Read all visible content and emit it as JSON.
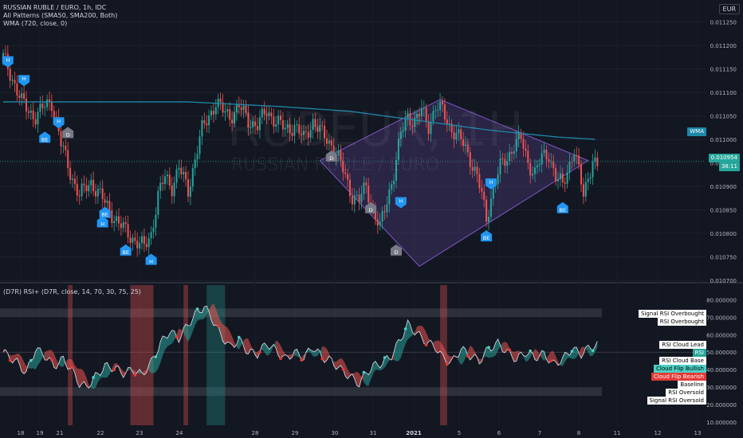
{
  "header": {
    "symbol_line": "RUSSIAN RUBLE / EURO, 1h, IDC",
    "patterns_line": "All Patterns (SMA50, SMA200, Both)",
    "wma_line": "WMA (720, close, 0)",
    "currency": "EUR"
  },
  "watermark": {
    "ticker": "RUBEUR, 1H",
    "name": "RUSSIAN RUBLE / EURO"
  },
  "price_tags": {
    "wma": "WMA",
    "last": "0.010954",
    "countdown": "38:11"
  },
  "rsi_header": "(D7R) RSI+ (D7R, close, 14, 70, 30, 75, 25)",
  "rsi_labels": [
    {
      "text": "Signal RSI Overbought",
      "bg": "#ffffff",
      "fg": "#000000"
    },
    {
      "text": "RSI Overbought",
      "bg": "#ffffff",
      "fg": "#000000"
    },
    {
      "text": "RSI Cloud Lead",
      "bg": "#ffffff",
      "fg": "#000000"
    },
    {
      "text": "RSI",
      "bg": "#26a69a",
      "fg": "#ffffff"
    },
    {
      "text": "RSI Cloud Base",
      "bg": "#ffffff",
      "fg": "#000000"
    },
    {
      "text": "Cloud Flip Bullish",
      "bg": "#4dd0c4",
      "fg": "#000000"
    },
    {
      "text": "Cloud Flip Bearish",
      "bg": "#e53935",
      "fg": "#ffffff"
    },
    {
      "text": "Baseline",
      "bg": "#ffffff",
      "fg": "#000000"
    },
    {
      "text": "RSI Oversold",
      "bg": "#ffffff",
      "fg": "#000000"
    },
    {
      "text": "Signal RSI Oversold",
      "bg": "#ffffff",
      "fg": "#000000"
    }
  ],
  "colors": {
    "up": "#26a69a",
    "down": "#ef5350",
    "wma": "#1e88a8",
    "diamond": "#7e57c2",
    "marker": "#2196f3",
    "marker_d": "#787b86",
    "bg": "#131722"
  },
  "chart_data": [
    {
      "type": "candlestick",
      "title": "RUSSIAN RUBLE / EURO, 1h, IDC",
      "y_ticks": [
        "0.011250",
        "0.011200",
        "0.011150",
        "0.011100",
        "0.011050",
        "0.011000",
        "0.010950",
        "0.010900",
        "0.010850",
        "0.010800",
        "0.010750",
        "0.010700"
      ],
      "ylim": [
        0.0107,
        0.01128
      ],
      "x_ticks": [
        "18",
        "19",
        "21",
        "22",
        "23",
        "24",
        "28",
        "29",
        "30",
        "31",
        "2021",
        "5",
        "6",
        "7",
        "8",
        "11",
        "12",
        "13"
      ],
      "close_path": [
        [
          0,
          0.011175
        ],
        [
          4,
          0.01113
        ],
        [
          8,
          0.01108
        ],
        [
          11,
          0.01106
        ],
        [
          14,
          0.01105
        ],
        [
          18,
          0.01107
        ],
        [
          21,
          0.01108
        ],
        [
          23,
          0.01104
        ],
        [
          25,
          0.01099
        ],
        [
          29,
          0.01093
        ],
        [
          33,
          0.01088
        ],
        [
          38,
          0.01091
        ],
        [
          42,
          0.01088
        ],
        [
          46,
          0.01085
        ],
        [
          50,
          0.01082
        ],
        [
          54,
          0.0108
        ],
        [
          58,
          0.01078
        ],
        [
          61,
          0.01077
        ],
        [
          64,
          0.0108
        ],
        [
          67,
          0.01088
        ],
        [
          70,
          0.01092
        ],
        [
          73,
          0.0109
        ],
        [
          76,
          0.01094
        ],
        [
          80,
          0.01089
        ],
        [
          83,
          0.01096
        ],
        [
          86,
          0.01102
        ],
        [
          89,
          0.01105
        ],
        [
          92,
          0.01108
        ],
        [
          95,
          0.01106
        ],
        [
          98,
          0.01105
        ],
        [
          102,
          0.01107
        ],
        [
          106,
          0.01104
        ],
        [
          110,
          0.01103
        ],
        [
          114,
          0.01106
        ],
        [
          118,
          0.01104
        ],
        [
          122,
          0.01102
        ],
        [
          126,
          0.01103
        ],
        [
          130,
          0.011
        ],
        [
          134,
          0.01104
        ],
        [
          138,
          0.01101
        ],
        [
          142,
          0.01099
        ],
        [
          145,
          0.01096
        ],
        [
          148,
          0.01092
        ],
        [
          151,
          0.01088
        ],
        [
          154,
          0.01087
        ],
        [
          157,
          0.0109
        ],
        [
          160,
          0.01085
        ],
        [
          163,
          0.01081
        ],
        [
          166,
          0.01087
        ],
        [
          169,
          0.01093
        ],
        [
          172,
          0.01101
        ],
        [
          175,
          0.01105
        ],
        [
          178,
          0.01104
        ],
        [
          181,
          0.01106
        ],
        [
          184,
          0.01103
        ],
        [
          187,
          0.01107
        ],
        [
          190,
          0.01106
        ],
        [
          193,
          0.01103
        ],
        [
          196,
          0.01101
        ],
        [
          199,
          0.01099
        ],
        [
          202,
          0.01096
        ],
        [
          205,
          0.01092
        ],
        [
          207,
          0.01088
        ],
        [
          209,
          0.01083
        ],
        [
          212,
          0.0109
        ],
        [
          215,
          0.01094
        ],
        [
          218,
          0.01096
        ],
        [
          221,
          0.01099
        ],
        [
          224,
          0.011
        ],
        [
          227,
          0.01095
        ],
        [
          230,
          0.01093
        ],
        [
          233,
          0.01096
        ],
        [
          236,
          0.01097
        ],
        [
          239,
          0.01092
        ],
        [
          242,
          0.0109
        ],
        [
          245,
          0.01095
        ],
        [
          247,
          0.01098
        ],
        [
          249,
          0.01093
        ],
        [
          251,
          0.01088
        ],
        [
          253,
          0.01092
        ],
        [
          255,
          0.01096
        ],
        [
          257,
          0.01094
        ]
      ],
      "wma": [
        [
          0,
          0.01108
        ],
        [
          40,
          0.01108
        ],
        [
          80,
          0.01108
        ],
        [
          120,
          0.01107
        ],
        [
          150,
          0.01106
        ],
        [
          180,
          0.01104
        ],
        [
          210,
          0.01102
        ],
        [
          240,
          0.011005
        ],
        [
          257,
          0.011
        ]
      ],
      "wedge_pattern": [
        [
          0.01094,
          0.01103
        ],
        [
          0.01108,
          0.01109
        ],
        [
          0.0109,
          0.01095
        ],
        [
          0.01073,
          0.01074
        ]
      ],
      "markers": [
        {
          "label": "H",
          "x": 2,
          "price": 0.01115,
          "side": "above"
        },
        {
          "label": "H",
          "x": 9,
          "price": 0.01111,
          "side": "above"
        },
        {
          "label": "H",
          "x": 24,
          "price": 0.01102,
          "side": "above"
        },
        {
          "label": "BE",
          "x": 18,
          "price": 0.01102,
          "side": "below"
        },
        {
          "label": "D",
          "x": 28,
          "price": 0.01103,
          "side": "below"
        },
        {
          "label": "BE",
          "x": 44,
          "price": 0.01086,
          "side": "below"
        },
        {
          "label": "H",
          "x": 43,
          "price": 0.01084,
          "side": "below"
        },
        {
          "label": "BE",
          "x": 53,
          "price": 0.01078,
          "side": "below"
        },
        {
          "label": "H",
          "x": 64,
          "price": 0.01076,
          "side": "below"
        },
        {
          "label": "D",
          "x": 142,
          "price": 0.01098,
          "side": "below"
        },
        {
          "label": "D",
          "x": 159,
          "price": 0.01087,
          "side": "below"
        },
        {
          "label": "H",
          "x": 172,
          "price": 0.01085,
          "side": "above"
        },
        {
          "label": "D",
          "x": 170,
          "price": 0.01078,
          "side": "below"
        },
        {
          "label": "H",
          "x": 211,
          "price": 0.01089,
          "side": "above"
        },
        {
          "label": "BE",
          "x": 209,
          "price": 0.01081,
          "side": "below"
        },
        {
          "label": "BE",
          "x": 242,
          "price": 0.01087,
          "side": "below"
        }
      ]
    },
    {
      "type": "line",
      "title": "(D7R) RSI+ (D7R, close, 14, 70, 30, 75, 25)",
      "ylim": [
        10,
        82
      ],
      "y_ticks": [
        "80.000000",
        "70.000000",
        "60.000000",
        "50.000000",
        "40.000000",
        "30.000000",
        "20.000000",
        "10.000000"
      ],
      "overbought": 70,
      "signal_overbought": 75,
      "oversold": 30,
      "signal_oversold": 25,
      "baseline": 50,
      "rsi_path": [
        [
          0,
          50
        ],
        [
          6,
          44
        ],
        [
          10,
          38
        ],
        [
          14,
          52
        ],
        [
          18,
          48
        ],
        [
          22,
          42
        ],
        [
          26,
          46
        ],
        [
          30,
          39
        ],
        [
          33,
          32
        ],
        [
          36,
          30
        ],
        [
          40,
          36
        ],
        [
          44,
          42
        ],
        [
          48,
          41
        ],
        [
          52,
          38
        ],
        [
          56,
          40
        ],
        [
          60,
          37
        ],
        [
          64,
          44
        ],
        [
          68,
          55
        ],
        [
          72,
          62
        ],
        [
          76,
          58
        ],
        [
          80,
          66
        ],
        [
          84,
          73
        ],
        [
          87,
          76
        ],
        [
          90,
          70
        ],
        [
          94,
          60
        ],
        [
          98,
          53
        ],
        [
          102,
          57
        ],
        [
          106,
          50
        ],
        [
          110,
          49
        ],
        [
          114,
          55
        ],
        [
          118,
          51
        ],
        [
          122,
          46
        ],
        [
          126,
          50
        ],
        [
          130,
          47
        ],
        [
          134,
          53
        ],
        [
          138,
          47
        ],
        [
          142,
          45
        ],
        [
          146,
          40
        ],
        [
          150,
          36
        ],
        [
          154,
          32
        ],
        [
          157,
          38
        ],
        [
          160,
          42
        ],
        [
          164,
          44
        ],
        [
          168,
          48
        ],
        [
          172,
          58
        ],
        [
          175,
          66
        ],
        [
          178,
          62
        ],
        [
          181,
          58
        ],
        [
          184,
          55
        ],
        [
          187,
          53
        ],
        [
          190,
          47
        ],
        [
          194,
          44
        ],
        [
          198,
          52
        ],
        [
          202,
          48
        ],
        [
          206,
          45
        ],
        [
          210,
          52
        ],
        [
          214,
          55
        ],
        [
          218,
          50
        ],
        [
          222,
          46
        ],
        [
          226,
          50
        ],
        [
          230,
          47
        ],
        [
          234,
          49
        ],
        [
          238,
          43
        ],
        [
          242,
          46
        ],
        [
          246,
          52
        ],
        [
          250,
          49
        ],
        [
          254,
          53
        ],
        [
          257,
          54
        ]
      ],
      "highlight_columns": {
        "red": [
          [
            28,
            30
          ],
          [
            55,
            65
          ],
          [
            78,
            80
          ],
          [
            189,
            192
          ]
        ],
        "teal": [
          [
            88,
            96
          ]
        ]
      }
    }
  ]
}
